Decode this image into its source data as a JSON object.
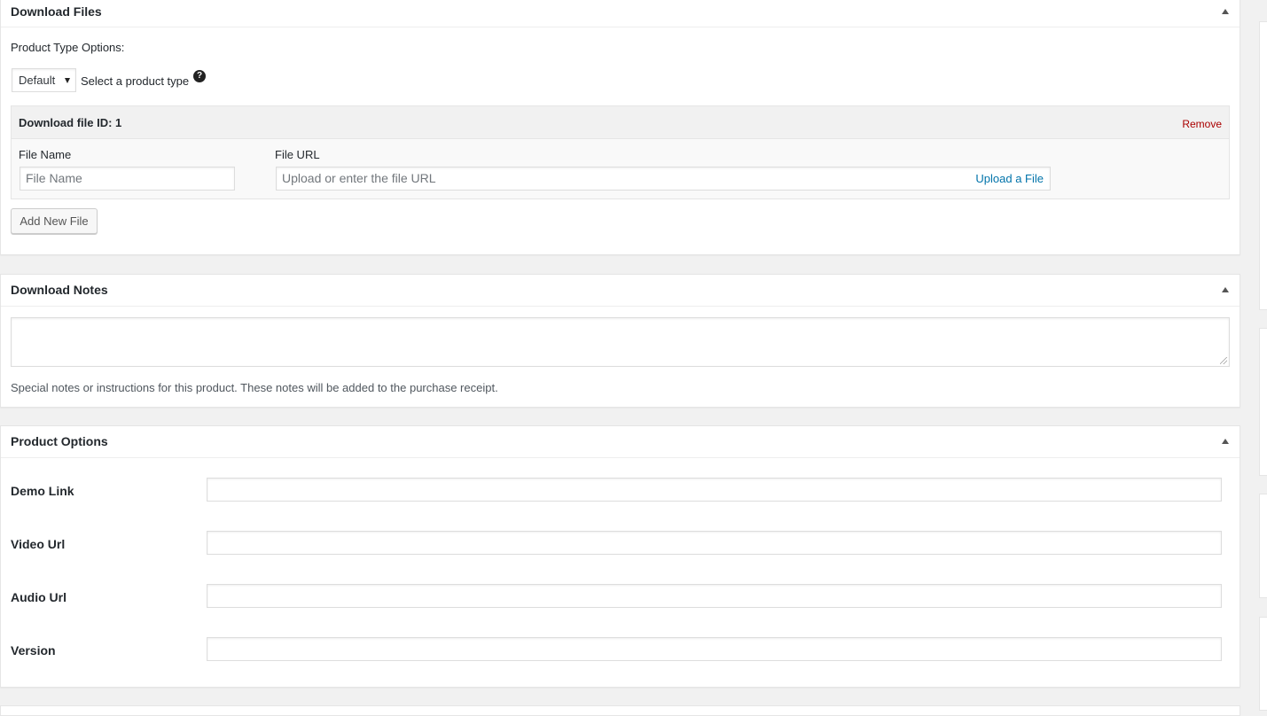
{
  "download_files": {
    "title": "Download Files",
    "product_type_label": "Product Type Options:",
    "product_type_select": {
      "selected": "Default"
    },
    "product_type_hint": "Select a product type",
    "help_icon": "?",
    "file_row": {
      "id_label": "Download file ID: 1",
      "remove_label": "Remove",
      "file_name_label": "File Name",
      "file_name_placeholder": "File Name",
      "file_url_label": "File URL",
      "file_url_placeholder": "Upload or enter the file URL",
      "upload_label": "Upload a File"
    },
    "add_new_file_label": "Add New File"
  },
  "download_notes": {
    "title": "Download Notes",
    "notes_value": "",
    "description": "Special notes or instructions for this product. These notes will be added to the purchase receipt."
  },
  "product_options": {
    "title": "Product Options",
    "fields": [
      {
        "label": "Demo Link",
        "value": ""
      },
      {
        "label": "Video Url",
        "value": ""
      },
      {
        "label": "Audio Url",
        "value": ""
      },
      {
        "label": "Version",
        "value": ""
      }
    ]
  },
  "colors": {
    "link": "#0073aa",
    "remove": "#aa0000",
    "page_bg": "#f1f1f1"
  }
}
